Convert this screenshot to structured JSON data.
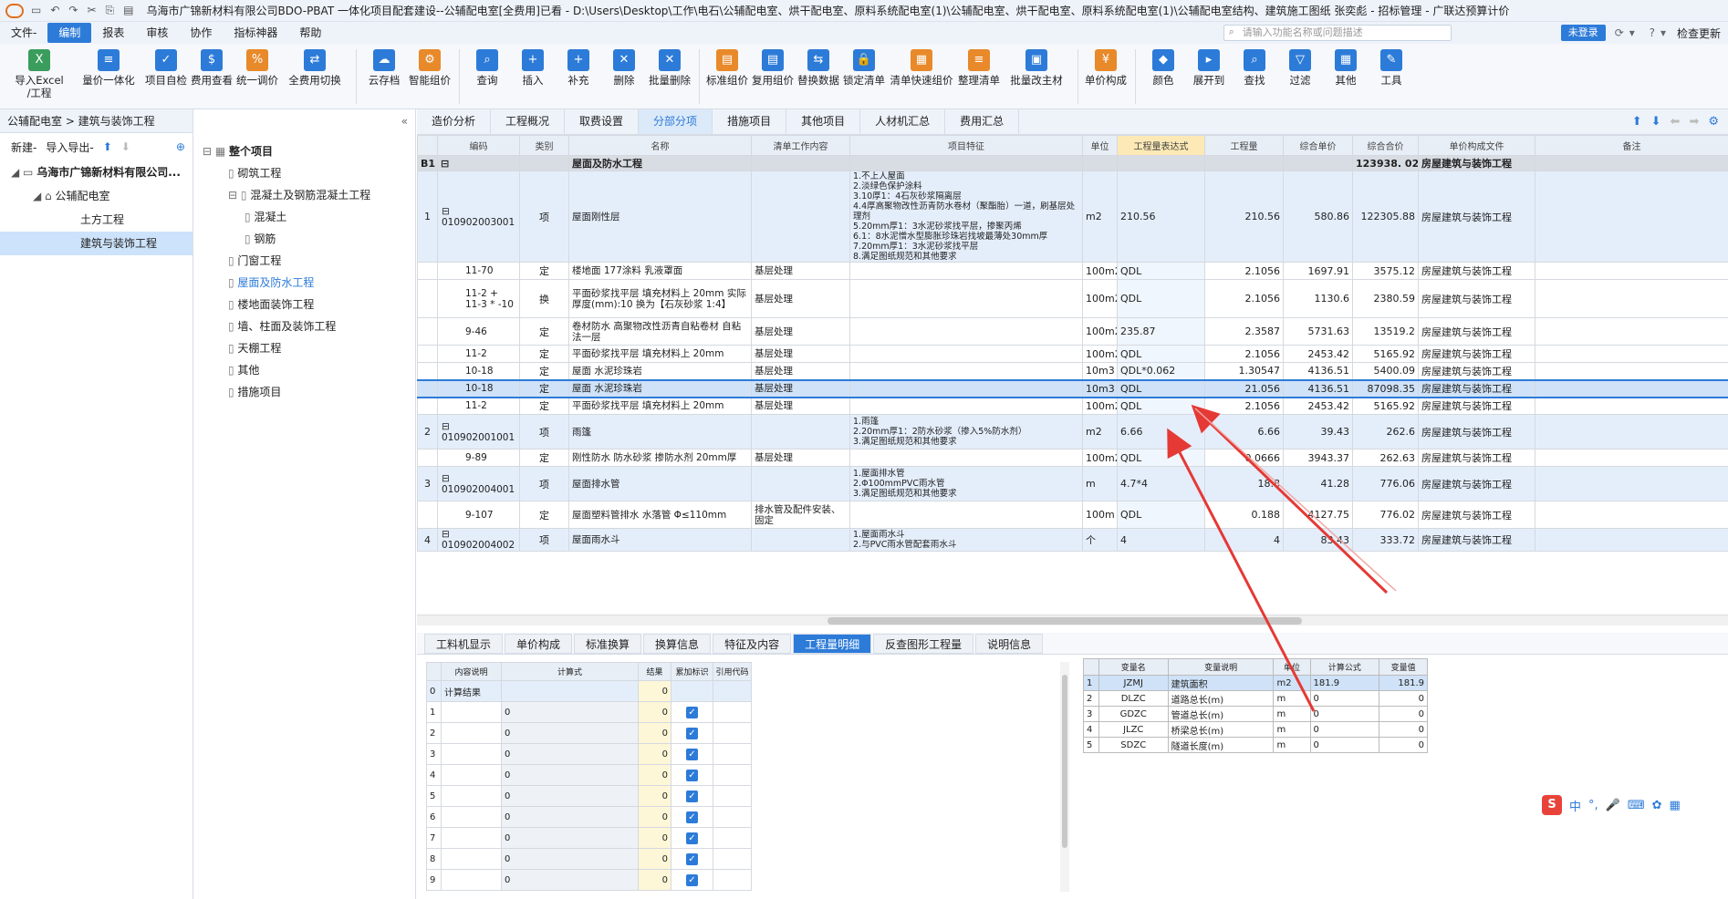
{
  "title": "乌海市广锦新材料有限公司BDO-PBAT 一体化项目配套建设--公辅配电室[全费用]已看 - D:\\Users\\Desktop\\工作\\电石\\公辅配电室、烘干配电室、原料系统配电室(1)\\公辅配电室、烘干配电室、原料系统配电室(1)\\公辅配电室结构、建筑施工图纸 张奕彪 - 招标管理 - 广联达预算计价",
  "menu": [
    "文件-",
    "编制",
    "报表",
    "审核",
    "协作",
    "指标神器",
    "帮助"
  ],
  "search_placeholder": "请输入功能名称或问题描述",
  "login": "未登录",
  "update": "检查更新",
  "ribbon": [
    {
      "label": "导入Excel\n/工程",
      "icon": "X",
      "c": "g"
    },
    {
      "label": "量价一体化",
      "icon": "≡",
      "c": ""
    },
    {
      "label": "项目自检",
      "icon": "✓",
      "c": ""
    },
    {
      "label": "费用查看",
      "icon": "$",
      "c": ""
    },
    {
      "label": "统一调价",
      "icon": "%",
      "c": "o"
    },
    {
      "label": "全费用切换",
      "icon": "⇄",
      "c": ""
    },
    {
      "label": "云存档",
      "icon": "☁",
      "c": ""
    },
    {
      "label": "智能组价",
      "icon": "⚙",
      "c": "o"
    },
    {
      "label": "查询",
      "icon": "⌕",
      "c": ""
    },
    {
      "label": "插入",
      "icon": "+",
      "c": ""
    },
    {
      "label": "补充",
      "icon": "+",
      "c": ""
    },
    {
      "label": "删除",
      "icon": "✕",
      "c": ""
    },
    {
      "label": "批量删除",
      "icon": "✕",
      "c": ""
    },
    {
      "label": "标准组价",
      "icon": "▤",
      "c": "o"
    },
    {
      "label": "复用组价",
      "icon": "▤",
      "c": ""
    },
    {
      "label": "替换数据",
      "icon": "⇆",
      "c": ""
    },
    {
      "label": "锁定清单",
      "icon": "🔒",
      "c": ""
    },
    {
      "label": "清单快速组价",
      "icon": "▦",
      "c": "o"
    },
    {
      "label": "整理清单",
      "icon": "≡",
      "c": "o"
    },
    {
      "label": "批量改主材",
      "icon": "▣",
      "c": ""
    },
    {
      "label": "单价构成",
      "icon": "¥",
      "c": "o"
    },
    {
      "label": "颜色",
      "icon": "◆",
      "c": ""
    },
    {
      "label": "展开到",
      "icon": "▸",
      "c": ""
    },
    {
      "label": "查找",
      "icon": "⌕",
      "c": ""
    },
    {
      "label": "过滤",
      "icon": "▽",
      "c": ""
    },
    {
      "label": "其他",
      "icon": "▦",
      "c": ""
    },
    {
      "label": "工具",
      "icon": "✎",
      "c": ""
    }
  ],
  "breadcrumb": "公辅配电室 > 建筑与装饰工程",
  "left_tools": [
    "新建-",
    "导入导出-"
  ],
  "project_tree": [
    {
      "label": "乌海市广锦新材料有限公司...",
      "level": 0,
      "sel": false
    },
    {
      "label": "公辅配电室",
      "level": 1,
      "sel": false
    },
    {
      "label": "土方工程",
      "level": 2,
      "sel": false
    },
    {
      "label": "建筑与装饰工程",
      "level": 2,
      "sel": true
    }
  ],
  "section_tree": [
    {
      "label": "整个项目",
      "level": 0
    },
    {
      "label": "砌筑工程",
      "level": 1
    },
    {
      "label": "混凝土及钢筋混凝土工程",
      "level": 1
    },
    {
      "label": "混凝土",
      "level": 2
    },
    {
      "label": "钢筋",
      "level": 2
    },
    {
      "label": "门窗工程",
      "level": 1
    },
    {
      "label": "屋面及防水工程",
      "level": 1,
      "cur": true
    },
    {
      "label": "楼地面装饰工程",
      "level": 1
    },
    {
      "label": "墙、柱面及装饰工程",
      "level": 1
    },
    {
      "label": "天棚工程",
      "level": 1
    },
    {
      "label": "其他",
      "level": 1
    },
    {
      "label": "措施项目",
      "level": 1
    }
  ],
  "tabs": [
    "造价分析",
    "工程概况",
    "取费设置",
    "分部分项",
    "措施项目",
    "其他项目",
    "人材机汇总",
    "费用汇总"
  ],
  "active_tab": "分部分项",
  "grid": {
    "headers": [
      "",
      "编码",
      "类别",
      "名称",
      "清单工作内容",
      "项目特征",
      "单位",
      "工程量表达式",
      "工程量",
      "综合单价",
      "综合合价",
      "单价构成文件",
      "备注"
    ],
    "section": {
      "no": "B1",
      "name": "屋面及防水工程",
      "total": "123938. 02",
      "file": "房屋建筑与装饰工程"
    },
    "rows": [
      {
        "type": "q",
        "no": "1",
        "code": "010902003001",
        "cat": "项",
        "name": "屋面刚性层",
        "work": "",
        "feat": "1.不上人屋面\n2.淡绿色保护涂料\n3.10厚1：4石灰砂浆隔离层\n4.4厚高聚物改性沥青防水卷材（聚酯胎）一道，刷基层处理剂\n5.20mm厚1：3水泥砂浆找平层，掺聚丙烯\n6.1：8水泥憎水型膨胀珍珠岩找坡最薄处30mm厚\n7.20mm厚1：3水泥砂浆找平层\n8.满足图纸规范和其他要求",
        "unit": "m2",
        "expr": "210.56",
        "qty": "210.56",
        "price": "580.86",
        "total": "122305.88",
        "file": "房屋建筑与装饰工程",
        "h": 100
      },
      {
        "type": "d",
        "no": "",
        "code": "11-70",
        "cat": "定",
        "name": "楼地面 177涂料 乳液罩面",
        "work": "基层处理",
        "feat": "",
        "unit": "100m2",
        "expr": "QDL",
        "qty": "2.1056",
        "price": "1697.91",
        "total": "3575.12",
        "file": "房屋建筑与装饰工程",
        "h": 19
      },
      {
        "type": "d",
        "no": "",
        "code": "11-2 +\n11-3 * -10",
        "cat": "换",
        "name": "平面砂浆找平层 填充材料上 20mm  实际厚度(mm):10  换为【石灰砂浆 1:4】",
        "work": "基层处理",
        "feat": "",
        "unit": "100m2",
        "expr": "QDL",
        "qty": "2.1056",
        "price": "1130.6",
        "total": "2380.59",
        "file": "房屋建筑与装饰工程",
        "h": 42
      },
      {
        "type": "d",
        "no": "",
        "code": "9-46",
        "cat": "定",
        "name": "卷材防水 高聚物改性沥青自粘卷材 自粘法一层",
        "work": "基层处理",
        "feat": "",
        "unit": "100m2",
        "expr": "235.87",
        "qty": "2.3587",
        "price": "5731.63",
        "total": "13519.2",
        "file": "房屋建筑与装饰工程",
        "h": 30
      },
      {
        "type": "d",
        "no": "",
        "code": "11-2",
        "cat": "定",
        "name": "平面砂浆找平层 填充材料上 20mm",
        "work": "基层处理",
        "feat": "",
        "unit": "100m2",
        "expr": "QDL",
        "qty": "2.1056",
        "price": "2453.42",
        "total": "5165.92",
        "file": "房屋建筑与装饰工程",
        "h": 19
      },
      {
        "type": "d",
        "no": "",
        "code": "10-18",
        "cat": "定",
        "name": "屋面 水泥珍珠岩",
        "work": "基层处理",
        "feat": "",
        "unit": "10m3",
        "expr": "QDL*0.062",
        "qty": "1.30547",
        "price": "4136.51",
        "total": "5400.09",
        "file": "房屋建筑与装饰工程",
        "h": 19
      },
      {
        "type": "sel",
        "no": "",
        "code": "10-18",
        "cat": "定",
        "name": "屋面 水泥珍珠岩",
        "work": "基层处理",
        "feat": "",
        "unit": "10m3",
        "expr": "QDL",
        "qty": "21.056",
        "price": "4136.51",
        "total": "87098.35",
        "file": "房屋建筑与装饰工程",
        "h": 19
      },
      {
        "type": "d",
        "no": "",
        "code": "11-2",
        "cat": "定",
        "name": "平面砂浆找平层 填充材料上 20mm",
        "work": "基层处理",
        "feat": "",
        "unit": "100m2",
        "expr": "QDL",
        "qty": "2.1056",
        "price": "2453.42",
        "total": "5165.92",
        "file": "房屋建筑与装饰工程",
        "h": 19
      },
      {
        "type": "q",
        "no": "2",
        "code": "010902001001",
        "cat": "项",
        "name": "雨篷",
        "work": "",
        "feat": "1.雨篷\n2.20mm厚1：2防水砂浆（掺入5%防水剂）\n3.满足图纸规范和其他要求",
        "unit": "m2",
        "expr": "6.66",
        "qty": "6.66",
        "price": "39.43",
        "total": "262.6",
        "file": "房屋建筑与装饰工程",
        "h": 38
      },
      {
        "type": "d",
        "no": "",
        "code": "9-89",
        "cat": "定",
        "name": "刚性防水 防水砂浆 掺防水剂 20mm厚",
        "work": "基层处理",
        "feat": "",
        "unit": "100m2",
        "expr": "QDL",
        "qty": "0.0666",
        "price": "3943.37",
        "total": "262.63",
        "file": "房屋建筑与装饰工程",
        "h": 19
      },
      {
        "type": "q",
        "no": "3",
        "code": "010902004001",
        "cat": "项",
        "name": "屋面排水管",
        "work": "",
        "feat": "1.屋面排水管\n2.Φ100mmPVC雨水管\n3.满足图纸规范和其他要求",
        "unit": "m",
        "expr": "4.7*4",
        "qty": "18.8",
        "price": "41.28",
        "total": "776.06",
        "file": "房屋建筑与装饰工程",
        "h": 38
      },
      {
        "type": "d",
        "no": "",
        "code": "9-107",
        "cat": "定",
        "name": "屋面塑料管排水 水落管 Φ≤110mm",
        "work": "排水管及配件安装、固定",
        "feat": "",
        "unit": "100m",
        "expr": "QDL",
        "qty": "0.188",
        "price": "4127.75",
        "total": "776.02",
        "file": "房屋建筑与装饰工程",
        "h": 30
      },
      {
        "type": "q",
        "no": "4",
        "code": "010902004002",
        "cat": "项",
        "name": "屋面雨水斗",
        "work": "",
        "feat": "1.屋面雨水斗\n2.与PVC雨水管配套雨水斗",
        "unit": "个",
        "expr": "4",
        "qty": "4",
        "price": "83.43",
        "total": "333.72",
        "file": "房屋建筑与装饰工程",
        "h": 20
      }
    ]
  },
  "bottom_tabs": [
    "工料机显示",
    "单价构成",
    "标准换算",
    "换算信息",
    "特征及内容",
    "工程量明细",
    "反查图形工程量",
    "说明信息"
  ],
  "active_bottom_tab": "工程量明细",
  "detail": {
    "headers": [
      "",
      "内容说明",
      "计算式",
      "结果",
      "累加标识",
      "引用代码"
    ],
    "first": {
      "no": "0",
      "desc": "计算结果",
      "result": "0"
    },
    "rows": [
      {
        "no": "1",
        "expr": "0",
        "res": "0"
      },
      {
        "no": "2",
        "expr": "0",
        "res": "0"
      },
      {
        "no": "3",
        "expr": "0",
        "res": "0"
      },
      {
        "no": "4",
        "expr": "0",
        "res": "0"
      },
      {
        "no": "5",
        "expr": "0",
        "res": "0"
      },
      {
        "no": "6",
        "expr": "0",
        "res": "0"
      },
      {
        "no": "7",
        "expr": "0",
        "res": "0"
      },
      {
        "no": "8",
        "expr": "0",
        "res": "0"
      },
      {
        "no": "9",
        "expr": "0",
        "res": "0"
      }
    ]
  },
  "vars": {
    "headers": [
      "",
      "变量名",
      "变量说明",
      "单位",
      "计算公式",
      "变量值"
    ],
    "rows": [
      {
        "no": "1",
        "name": "JZMJ",
        "desc": "建筑面积",
        "unit": "m2",
        "formula": "181.9",
        "value": "181.9",
        "sel": true
      },
      {
        "no": "2",
        "name": "DLZC",
        "desc": "道路总长(m)",
        "unit": "m",
        "formula": "0",
        "value": "0"
      },
      {
        "no": "3",
        "name": "GDZC",
        "desc": "管道总长(m)",
        "unit": "m",
        "formula": "0",
        "value": "0"
      },
      {
        "no": "4",
        "name": "JLZC",
        "desc": "桥梁总长(m)",
        "unit": "m",
        "formula": "0",
        "value": "0"
      },
      {
        "no": "5",
        "name": "SDZC",
        "desc": "隧道长度(m)",
        "unit": "m",
        "formula": "0",
        "value": "0"
      }
    ]
  },
  "ime": {
    "logo": "S",
    "lang": "中"
  },
  "colors": {
    "accent": "#2d7bd8",
    "arrow": "#e53935"
  }
}
